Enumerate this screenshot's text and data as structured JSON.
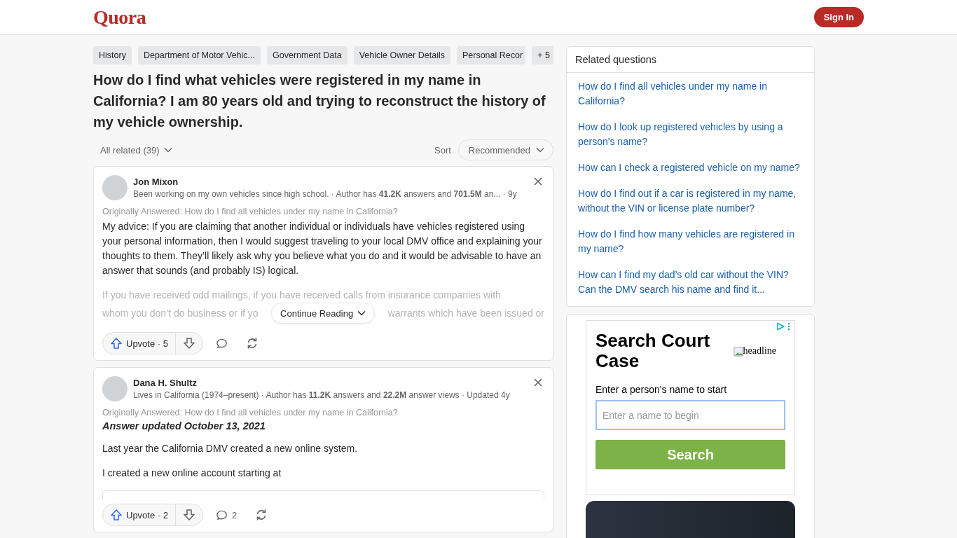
{
  "header": {
    "logo": "Quora",
    "sign_in": "Sign In"
  },
  "topics": {
    "items": [
      "History",
      "Department of Motor Vehic...",
      "Government Data",
      "Vehicle Owner Details",
      "Personal Recor"
    ],
    "more": "+ 5"
  },
  "question": "How do I find what vehicles were registered in my name in California? I am 80 years old and trying to reconstruct the history of my vehicle ownership.",
  "filter": {
    "all_related": "All related (39)",
    "sort_label": "Sort",
    "sort_value": "Recommended"
  },
  "answers": [
    {
      "author": "Jon Mixon",
      "credential": "Been working on my own vehicles since high school. · Author has **41.2K** answers and **701.5M** an... · 9y",
      "originally": "Originally Answered: How do I find all vehicles under my name in California?",
      "paragraphs": [
        "My advice: If you are claiming that another individual or individuals have vehicles registered using your personal information, then I would suggest traveling to your local DMV office and explaining your thoughts to them. They’ll likely ask why you believe what you do and it would be advisable to have an answer that sounds (and probably IS) logical."
      ],
      "faded": {
        "line_1": "If you have received odd mailings, if you have received calls from insurance companies with",
        "line_2_start": "whom you don’t do business or if yo",
        "line_2_end": "warrants which have been issued or"
      },
      "continue": "Continue Reading",
      "upvote": "Upvote · 5"
    },
    {
      "author": "Dana H. Shultz",
      "credential": "Lives in California (1974–present) · Author has **11.2K** answers and **22.2M** answer views · Updated 4y",
      "originally": "Originally Answered: How do I find all vehicles under my name in California?",
      "heading": "Answer updated October 13, 2021",
      "paragraphs": [
        "Last year the California DMV created a new online system.",
        "I created a new online account starting at"
      ],
      "embed": true,
      "upvote": "Upvote · 2",
      "comments": "2"
    }
  ],
  "related": {
    "title": "Related questions",
    "questions": [
      "How do I find all vehicles under my name in California?",
      "How do I look up registered vehicles by using a person's name?",
      "How can I check a registered vehicle on my name?",
      "How do I find out if a car is registered in my name, without the VIN or license plate number?",
      "How do I find how many vehicles are registered in my name?",
      "How can I find my dad’s old car without the VIN? Can the DMV search his name and find it..."
    ]
  },
  "ad": {
    "title": "Search Court Case",
    "image_alt": "headline",
    "label": "Enter a person's name to start",
    "placeholder": "Enter a name to begin",
    "button": "Search"
  }
}
